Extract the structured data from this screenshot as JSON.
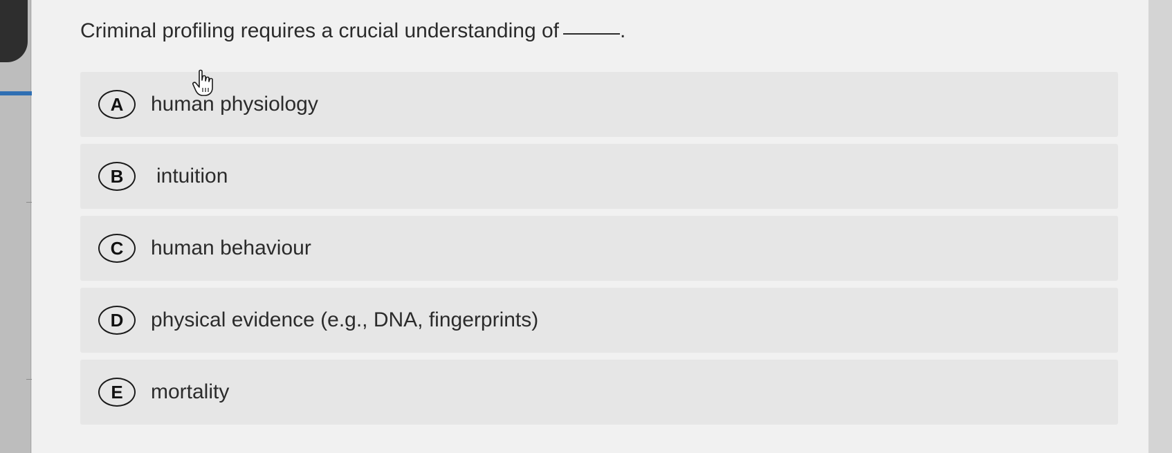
{
  "question": {
    "text": "Criminal profiling requires a crucial understanding of",
    "end": "."
  },
  "options": [
    {
      "letter": "A",
      "text": "human physiology"
    },
    {
      "letter": "B",
      "text": "intuition"
    },
    {
      "letter": "C",
      "text": "human behaviour"
    },
    {
      "letter": "D",
      "text": "physical evidence (e.g., DNA, fingerprints)"
    },
    {
      "letter": "E",
      "text": "mortality"
    }
  ],
  "cursor": {
    "icon": "hand-pointer-icon"
  },
  "colors": {
    "card_background": "#f1f1f1",
    "option_background": "#e6e6e6",
    "text": "#2b2b2b",
    "accent": "#2f6fb3"
  }
}
